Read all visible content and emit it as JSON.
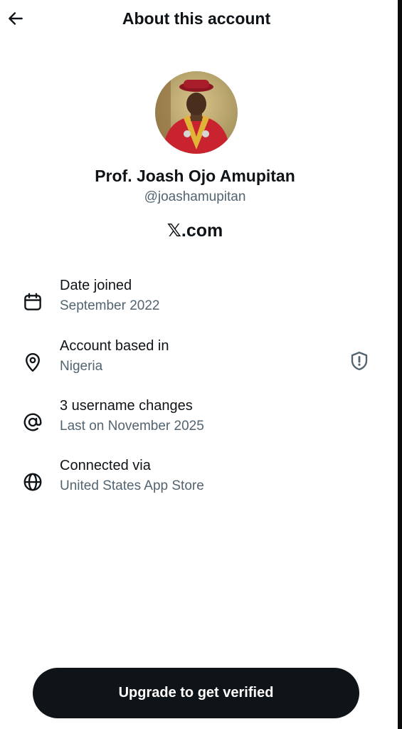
{
  "header": {
    "title": "About this account",
    "back_icon": "arrow-left-icon"
  },
  "profile": {
    "name": "Prof. Joash Ojo Amupitan",
    "handle": "@joashamupitan",
    "site": "𝕏.com"
  },
  "details": [
    {
      "icon": "calendar-icon",
      "label": "Date joined",
      "value": "September 2022"
    },
    {
      "icon": "location-pin-icon",
      "label": "Account based in",
      "value": "Nigeria",
      "badge_icon": "shield-alert-icon"
    },
    {
      "icon": "at-sign-icon",
      "label": "3 username changes",
      "value": "Last on November 2025"
    },
    {
      "icon": "globe-icon",
      "label": "Connected via",
      "value": "United States App Store"
    }
  ],
  "cta": {
    "label": "Upgrade to get verified"
  },
  "colors": {
    "text_primary": "#0f1419",
    "text_secondary": "#536471",
    "button_bg": "#0f1419",
    "button_text": "#ffffff"
  }
}
